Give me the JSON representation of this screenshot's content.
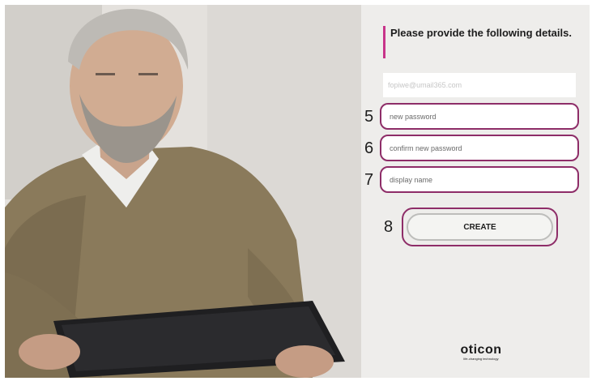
{
  "form": {
    "heading": "Please provide the following details.",
    "email_value": "fopiwe@umail365.com",
    "new_password_placeholder": "new password",
    "confirm_password_placeholder": "confirm new password",
    "display_name_placeholder": "display name",
    "create_label": "CREATE"
  },
  "annotations": {
    "step_5": "5",
    "step_6": "6",
    "step_7": "7",
    "step_8": "8"
  },
  "brand": {
    "logo_text": "oticon",
    "tagline": "life-changing technology",
    "accent_color": "#c8348a",
    "outline_color": "#8e2d68"
  },
  "icons": {
    "hero": "person-with-tablet-photo"
  }
}
